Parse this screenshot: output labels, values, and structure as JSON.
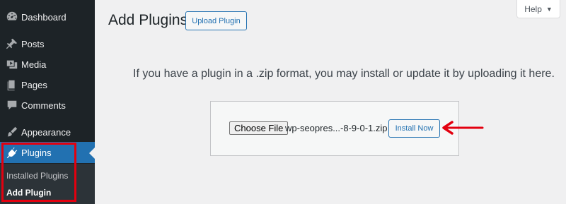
{
  "sidebar": {
    "items": [
      {
        "label": "Dashboard",
        "icon": "dashboard-icon"
      },
      {
        "label": "Posts",
        "icon": "pin-icon"
      },
      {
        "label": "Media",
        "icon": "media-icon"
      },
      {
        "label": "Pages",
        "icon": "pages-icon"
      },
      {
        "label": "Comments",
        "icon": "comments-icon"
      },
      {
        "label": "Appearance",
        "icon": "brush-icon"
      },
      {
        "label": "Plugins",
        "icon": "plugin-icon"
      }
    ],
    "submenu": [
      {
        "label": "Installed Plugins"
      },
      {
        "label": "Add Plugin"
      }
    ],
    "active_color": "#2271b1"
  },
  "header": {
    "title": "Add Plugins",
    "upload_label": "Upload Plugin",
    "help_label": "Help"
  },
  "main": {
    "help_text": "If you have a plugin in a .zip format, you may install or update it by uploading it here.",
    "choose_file_label": "Choose File",
    "file_name": "wp-seopres...-8-9-0-1.zip",
    "install_label": "Install Now"
  },
  "annotation_color": "#e3000f"
}
